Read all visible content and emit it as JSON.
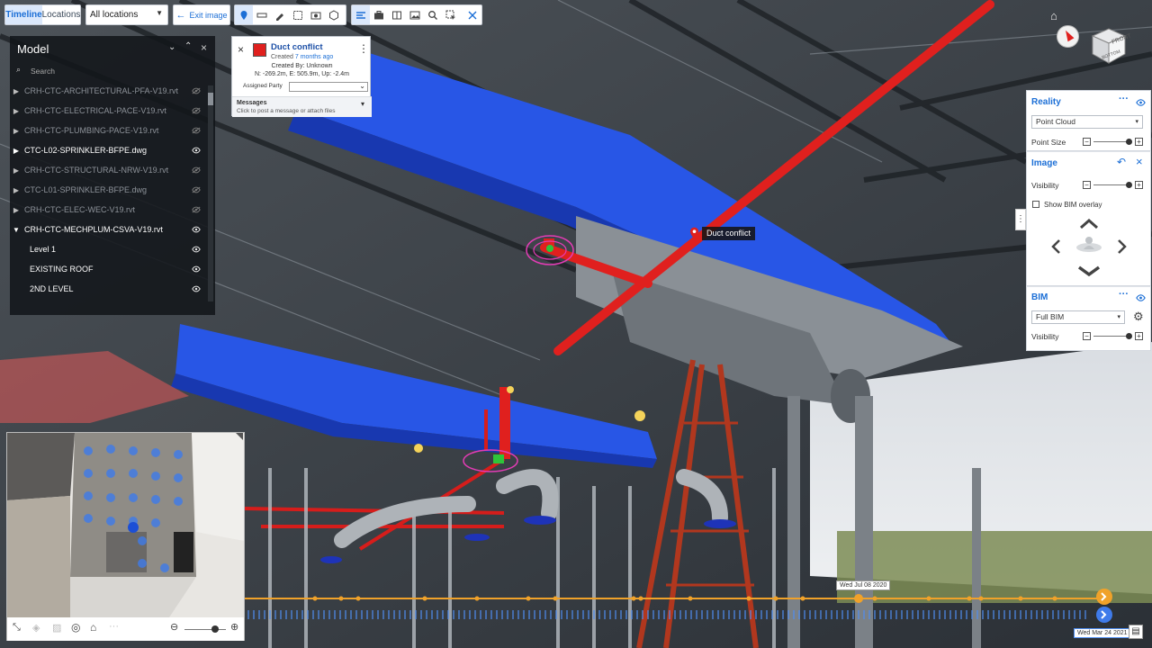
{
  "toolbar": {
    "timeline_tab": "Timeline",
    "locations_tab": "Locations",
    "location_select": "All locations",
    "exit_image": "Exit image"
  },
  "model_panel": {
    "title": "Model",
    "search_placeholder": "Search",
    "items": [
      {
        "label": "CRH-CTC-ARCHITECTURAL-PFA-V19.rvt",
        "dim": true
      },
      {
        "label": "CRH-CTC-ELECTRICAL-PACE-V19.rvt",
        "dim": true
      },
      {
        "label": "CRH-CTC-PLUMBING-PACE-V19.rvt",
        "dim": true
      },
      {
        "label": "CTC-L02-SPRINKLER-BFPE.dwg",
        "dim": false
      },
      {
        "label": "CRH-CTC-STRUCTURAL-NRW-V19.rvt",
        "dim": true
      },
      {
        "label": "CTC-L01-SPRINKLER-BFPE.dwg",
        "dim": true
      },
      {
        "label": "CRH-CTC-ELEC-WEC-V19.rvt",
        "dim": true
      },
      {
        "label": "CRH-CTC-MECHPLUM-CSVA-V19.rvt",
        "dim": false
      },
      {
        "label": "Level 1",
        "dim": false
      },
      {
        "label": "EXISTING ROOF",
        "dim": false
      },
      {
        "label": "2ND LEVEL",
        "dim": false
      }
    ]
  },
  "issue_card": {
    "title": "Duct conflict",
    "created_prefix": "Created",
    "created_ago": "7 months ago",
    "created_by": "Created By: Unknown",
    "coords": "N: -269.2m, E: 505.9m, Up: -2.4m",
    "assigned_label": "Assigned Party",
    "messages_title": "Messages",
    "messages_hint": "Click to post a message or attach files"
  },
  "marker_label": "Duct conflict",
  "right_panel": {
    "reality": {
      "title": "Reality",
      "select": "Point Cloud",
      "point_size": "Point Size"
    },
    "image": {
      "title": "Image",
      "visibility": "Visibility",
      "show_overlay": "Show BIM overlay"
    },
    "bim": {
      "title": "BIM",
      "select": "Full BIM",
      "visibility": "Visibility"
    }
  },
  "cube": {
    "front": "FRONT",
    "bottom": "BOTTOM"
  },
  "timeline": {
    "current_date": "Wed Jul 08 2020",
    "end_date": "Wed Mar 24 2021"
  },
  "colors": {
    "accent": "#1c6fd6",
    "issue": "#e0201e",
    "timeline": "#f0a22a",
    "duct": "#2451e0"
  }
}
